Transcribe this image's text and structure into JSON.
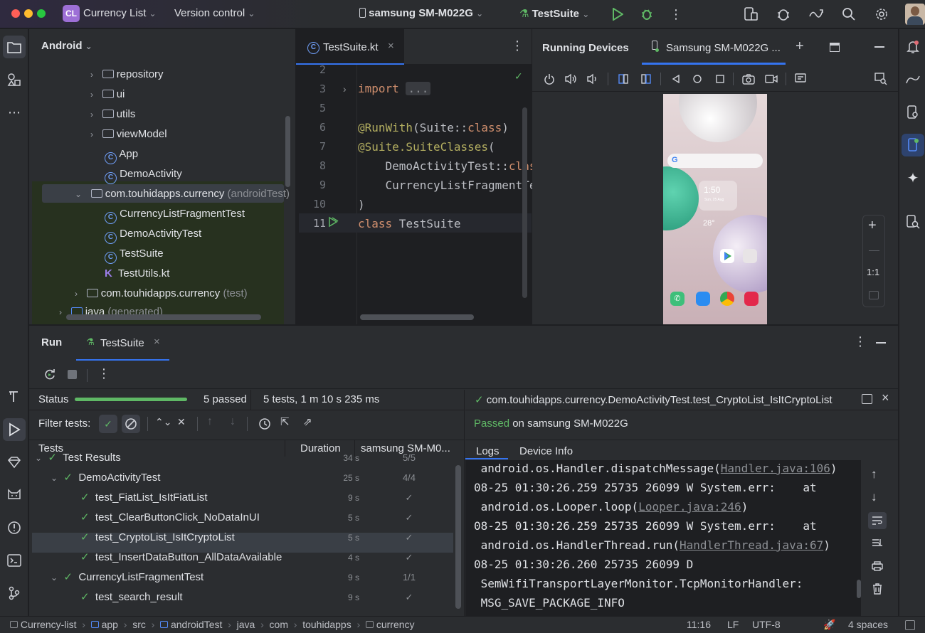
{
  "titlebar": {
    "project_badge": "CL",
    "project_name": "Currency List",
    "version_control": "Version control",
    "device": "samsung SM-M022G",
    "run_config": "TestSuite"
  },
  "project_panel": {
    "view_mode": "Android",
    "tree": [
      {
        "label": "repository",
        "suffix": "",
        "kind": "folder"
      },
      {
        "label": "ui",
        "suffix": "",
        "kind": "folder"
      },
      {
        "label": "utils",
        "suffix": "",
        "kind": "folder"
      },
      {
        "label": "viewModel",
        "suffix": "",
        "kind": "folder"
      },
      {
        "label": "App",
        "suffix": "",
        "kind": "class"
      },
      {
        "label": "DemoActivity",
        "suffix": "",
        "kind": "class"
      },
      {
        "label": "com.touhidapps.currency",
        "suffix": "(androidTest)",
        "kind": "package"
      },
      {
        "label": "CurrencyListFragmentTest",
        "suffix": "",
        "kind": "class"
      },
      {
        "label": "DemoActivityTest",
        "suffix": "",
        "kind": "class"
      },
      {
        "label": "TestSuite",
        "suffix": "",
        "kind": "class"
      },
      {
        "label": "TestUtils.kt",
        "suffix": "",
        "kind": "kotlin"
      },
      {
        "label": "com.touhidapps.currency",
        "suffix": "(test)",
        "kind": "package"
      },
      {
        "label": "java",
        "suffix": "(generated)",
        "kind": "folder"
      }
    ]
  },
  "editor": {
    "tab": "TestSuite.kt",
    "lines": [
      {
        "n": "2",
        "code": ""
      },
      {
        "n": "3",
        "code": "import ..."
      },
      {
        "n": "5",
        "code": ""
      },
      {
        "n": "6",
        "code": "@RunWith(Suite::class)"
      },
      {
        "n": "7",
        "code": "@Suite.SuiteClasses("
      },
      {
        "n": "8",
        "code": "    DemoActivityTest::clas"
      },
      {
        "n": "9",
        "code": "    CurrencyListFragmentTe"
      },
      {
        "n": "10",
        "code": ")"
      },
      {
        "n": "11",
        "code": "class TestSuite"
      }
    ]
  },
  "devices": {
    "title": "Running Devices",
    "tab": "Samsung SM-M022G ...",
    "zoom_label": "1:1",
    "phone": {
      "time": "1:50",
      "date": "Sun, 25 Aug",
      "temp": "28°"
    }
  },
  "run": {
    "title": "Run",
    "tab": "TestSuite",
    "status_label": "Status",
    "progress": 1.0,
    "passed": "5 passed",
    "summary": "5 tests, 1 m 10 s 235 ms",
    "filter_label": "Filter tests:",
    "columns": {
      "tests": "Tests",
      "duration": "Duration",
      "device": "samsung SM-M0..."
    },
    "rows": [
      {
        "label": "Test Results",
        "level": 0,
        "duration": "34 s",
        "result": "5/5",
        "expandable": true
      },
      {
        "label": "DemoActivityTest",
        "level": 1,
        "duration": "25 s",
        "result": "4/4",
        "expandable": true
      },
      {
        "label": "test_FiatList_IsItFiatList",
        "level": 2,
        "duration": "9 s",
        "result": "✓",
        "expandable": false
      },
      {
        "label": "test_ClearButtonClick_NoDataInUI",
        "level": 2,
        "duration": "5 s",
        "result": "✓",
        "expandable": false
      },
      {
        "label": "test_CryptoList_IsItCryptoList",
        "level": 2,
        "duration": "5 s",
        "result": "✓",
        "expandable": false,
        "selected": true
      },
      {
        "label": "test_InsertDataButton_AllDataAvailable",
        "level": 2,
        "duration": "4 s",
        "result": "✓",
        "expandable": false
      },
      {
        "label": "CurrencyListFragmentTest",
        "level": 1,
        "duration": "9 s",
        "result": "1/1",
        "expandable": true
      },
      {
        "label": "test_search_result",
        "level": 2,
        "duration": "9 s",
        "result": "✓",
        "expandable": false
      }
    ],
    "detail": {
      "test_name": "com.touhidapps.currency.DemoActivityTest.test_CryptoList_IsItCryptoList",
      "passed_word": "Passed",
      "passed_on": "on samsung SM-M022G",
      "tabs": [
        "Logs",
        "Device Info"
      ],
      "log_lines": [
        {
          "text": " android.os.Handler.dispatchMessage(",
          "link": "Handler.java:106",
          "tail": ")"
        },
        {
          "text": "08-25 01:30:26.259 25735 26099 W System.err:    at",
          "link": "",
          "tail": ""
        },
        {
          "text": " android.os.Looper.loop(",
          "link": "Looper.java:246",
          "tail": ")"
        },
        {
          "text": "08-25 01:30:26.259 25735 26099 W System.err:    at",
          "link": "",
          "tail": ""
        },
        {
          "text": " android.os.HandlerThread.run(",
          "link": "HandlerThread.java:67",
          "tail": ")"
        },
        {
          "text": "08-25 01:30:26.260 25735 26099 D",
          "link": "",
          "tail": ""
        },
        {
          "text": " SemWifiTransportLayerMonitor.TcpMonitorHandler:",
          "link": "",
          "tail": ""
        },
        {
          "text": " MSG_SAVE_PACKAGE_INFO",
          "link": "",
          "tail": ""
        }
      ]
    }
  },
  "statusbar": {
    "breadcrumb": [
      "Currency-list",
      "app",
      "src",
      "androidTest",
      "java",
      "com",
      "touhidapps",
      "currency"
    ],
    "position": "11:16",
    "line_sep": "LF",
    "encoding": "UTF-8",
    "indent": "4 spaces"
  },
  "colors": {
    "accent": "#3574f0",
    "success": "#5fb865",
    "keyword": "#cf8e6d",
    "annotation": "#b3ae60"
  }
}
